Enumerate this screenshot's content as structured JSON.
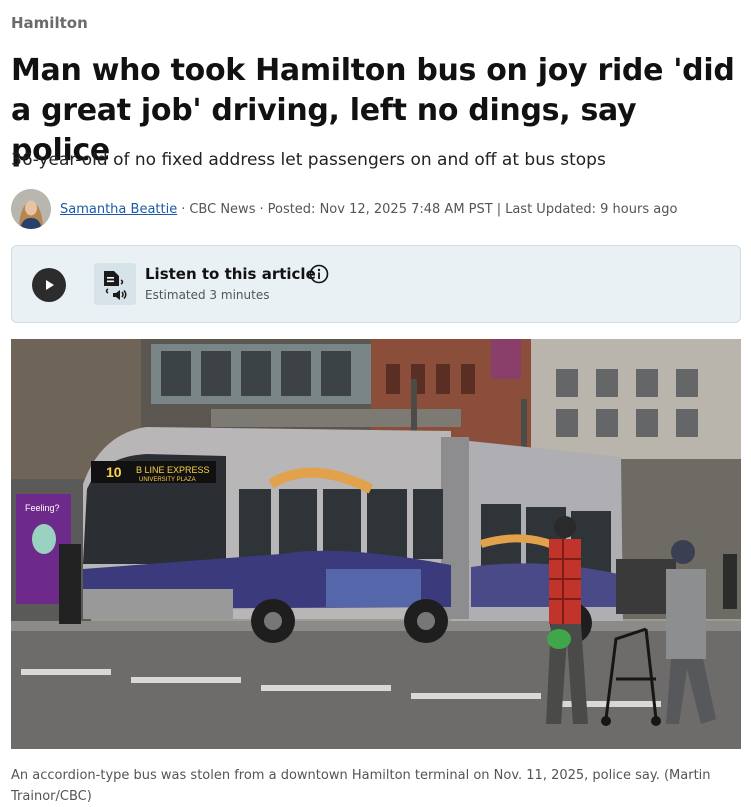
{
  "section": {
    "label": "Hamilton"
  },
  "article": {
    "headline": "Man who took Hamilton bus on joy ride 'did a great job' driving, left no dings, say police",
    "deck": "36-year-old of no fixed address let passengers on and off at bus stops"
  },
  "byline": {
    "author": "Samantha Beattie",
    "outlet": "CBC News",
    "posted": "Posted: Nov 12, 2025 7:48 AM PST",
    "updated": "Last Updated: 9 hours ago",
    "dot_sep": "·",
    "bar_sep": "|"
  },
  "listen": {
    "title": "Listen to this article",
    "estimate": "Estimated 3 minutes"
  },
  "photo": {
    "bus_route": "10",
    "bus_sign": "B LINE EXPRESS",
    "bus_sign_sub": "UNIVERSITY PLAZA",
    "poster_text": "Feeling?",
    "caption": "An accordion-type bus was stolen from a downtown Hamilton terminal on Nov. 11, 2025, police say. (Martin Trainor/CBC)"
  },
  "colors": {
    "accent_link": "#1c5aa6",
    "listen_bg": "#eaf1f4",
    "play_button": "#2c2c2c"
  },
  "icons": [
    "play-icon",
    "audio-document-icon",
    "info-icon"
  ]
}
